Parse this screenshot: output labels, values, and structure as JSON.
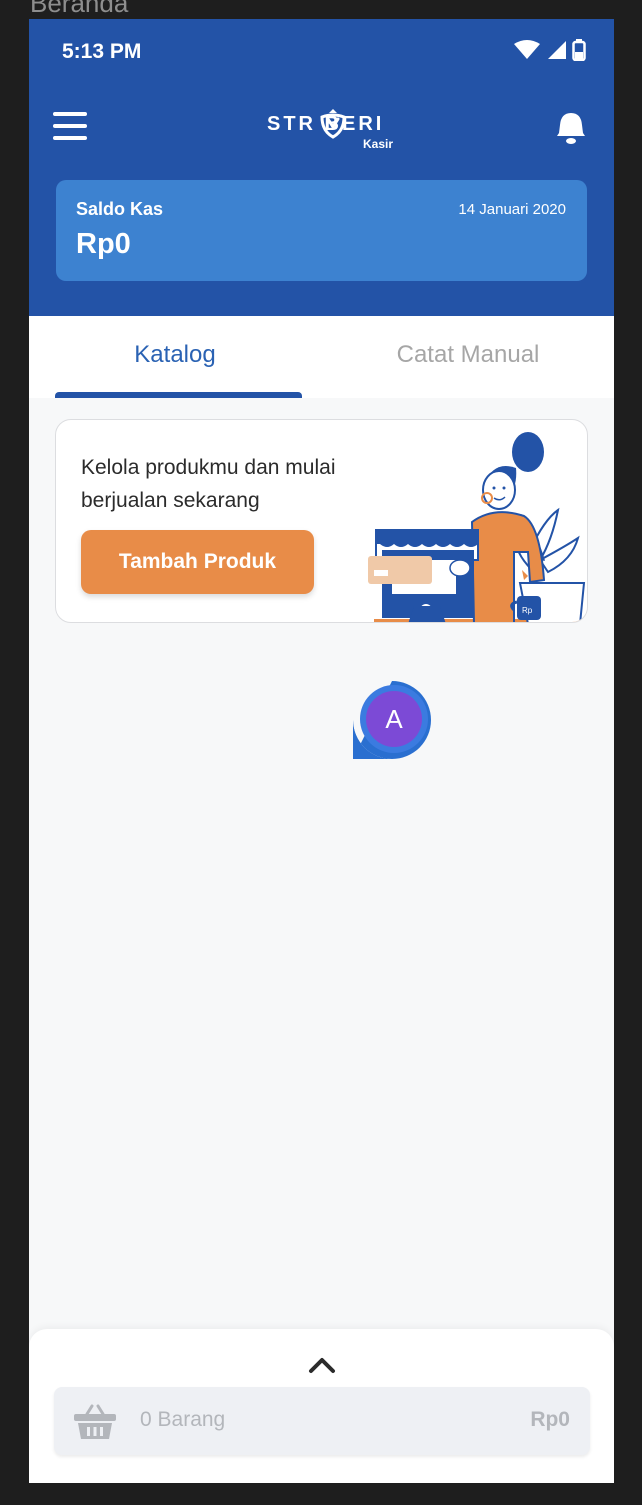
{
  "window": {
    "title": "Beranda"
  },
  "status_bar": {
    "time": "5:13 PM"
  },
  "app_bar": {
    "logo_text": "STR BERI",
    "logo_sub": "Kasir"
  },
  "saldo": {
    "label": "Saldo Kas",
    "date": "14 Januari 2020",
    "value": "Rp0"
  },
  "tabs": [
    {
      "label": "Katalog",
      "active": true
    },
    {
      "label": "Catat Manual",
      "active": false
    }
  ],
  "promo": {
    "text": "Kelola produkmu dan mulai berjualan sekarang",
    "button_label": "Tambah Produk",
    "illustration_cup_label": "Rp"
  },
  "fab": {
    "label": "A"
  },
  "cart": {
    "count_label": "0 Barang",
    "total": "Rp0"
  },
  "colors": {
    "primary": "#2353a7",
    "card_blue": "#3d82d0",
    "accent_orange": "#e88c48",
    "tab_active": "#2a62b3",
    "fab_purple": "#7c4ad6"
  },
  "icons": {
    "menu": "hamburger-icon",
    "notification": "bell-icon",
    "wifi": "wifi-icon",
    "signal": "signal-icon",
    "battery": "battery-icon",
    "expand": "chevron-up-icon",
    "cart": "basket-icon"
  }
}
